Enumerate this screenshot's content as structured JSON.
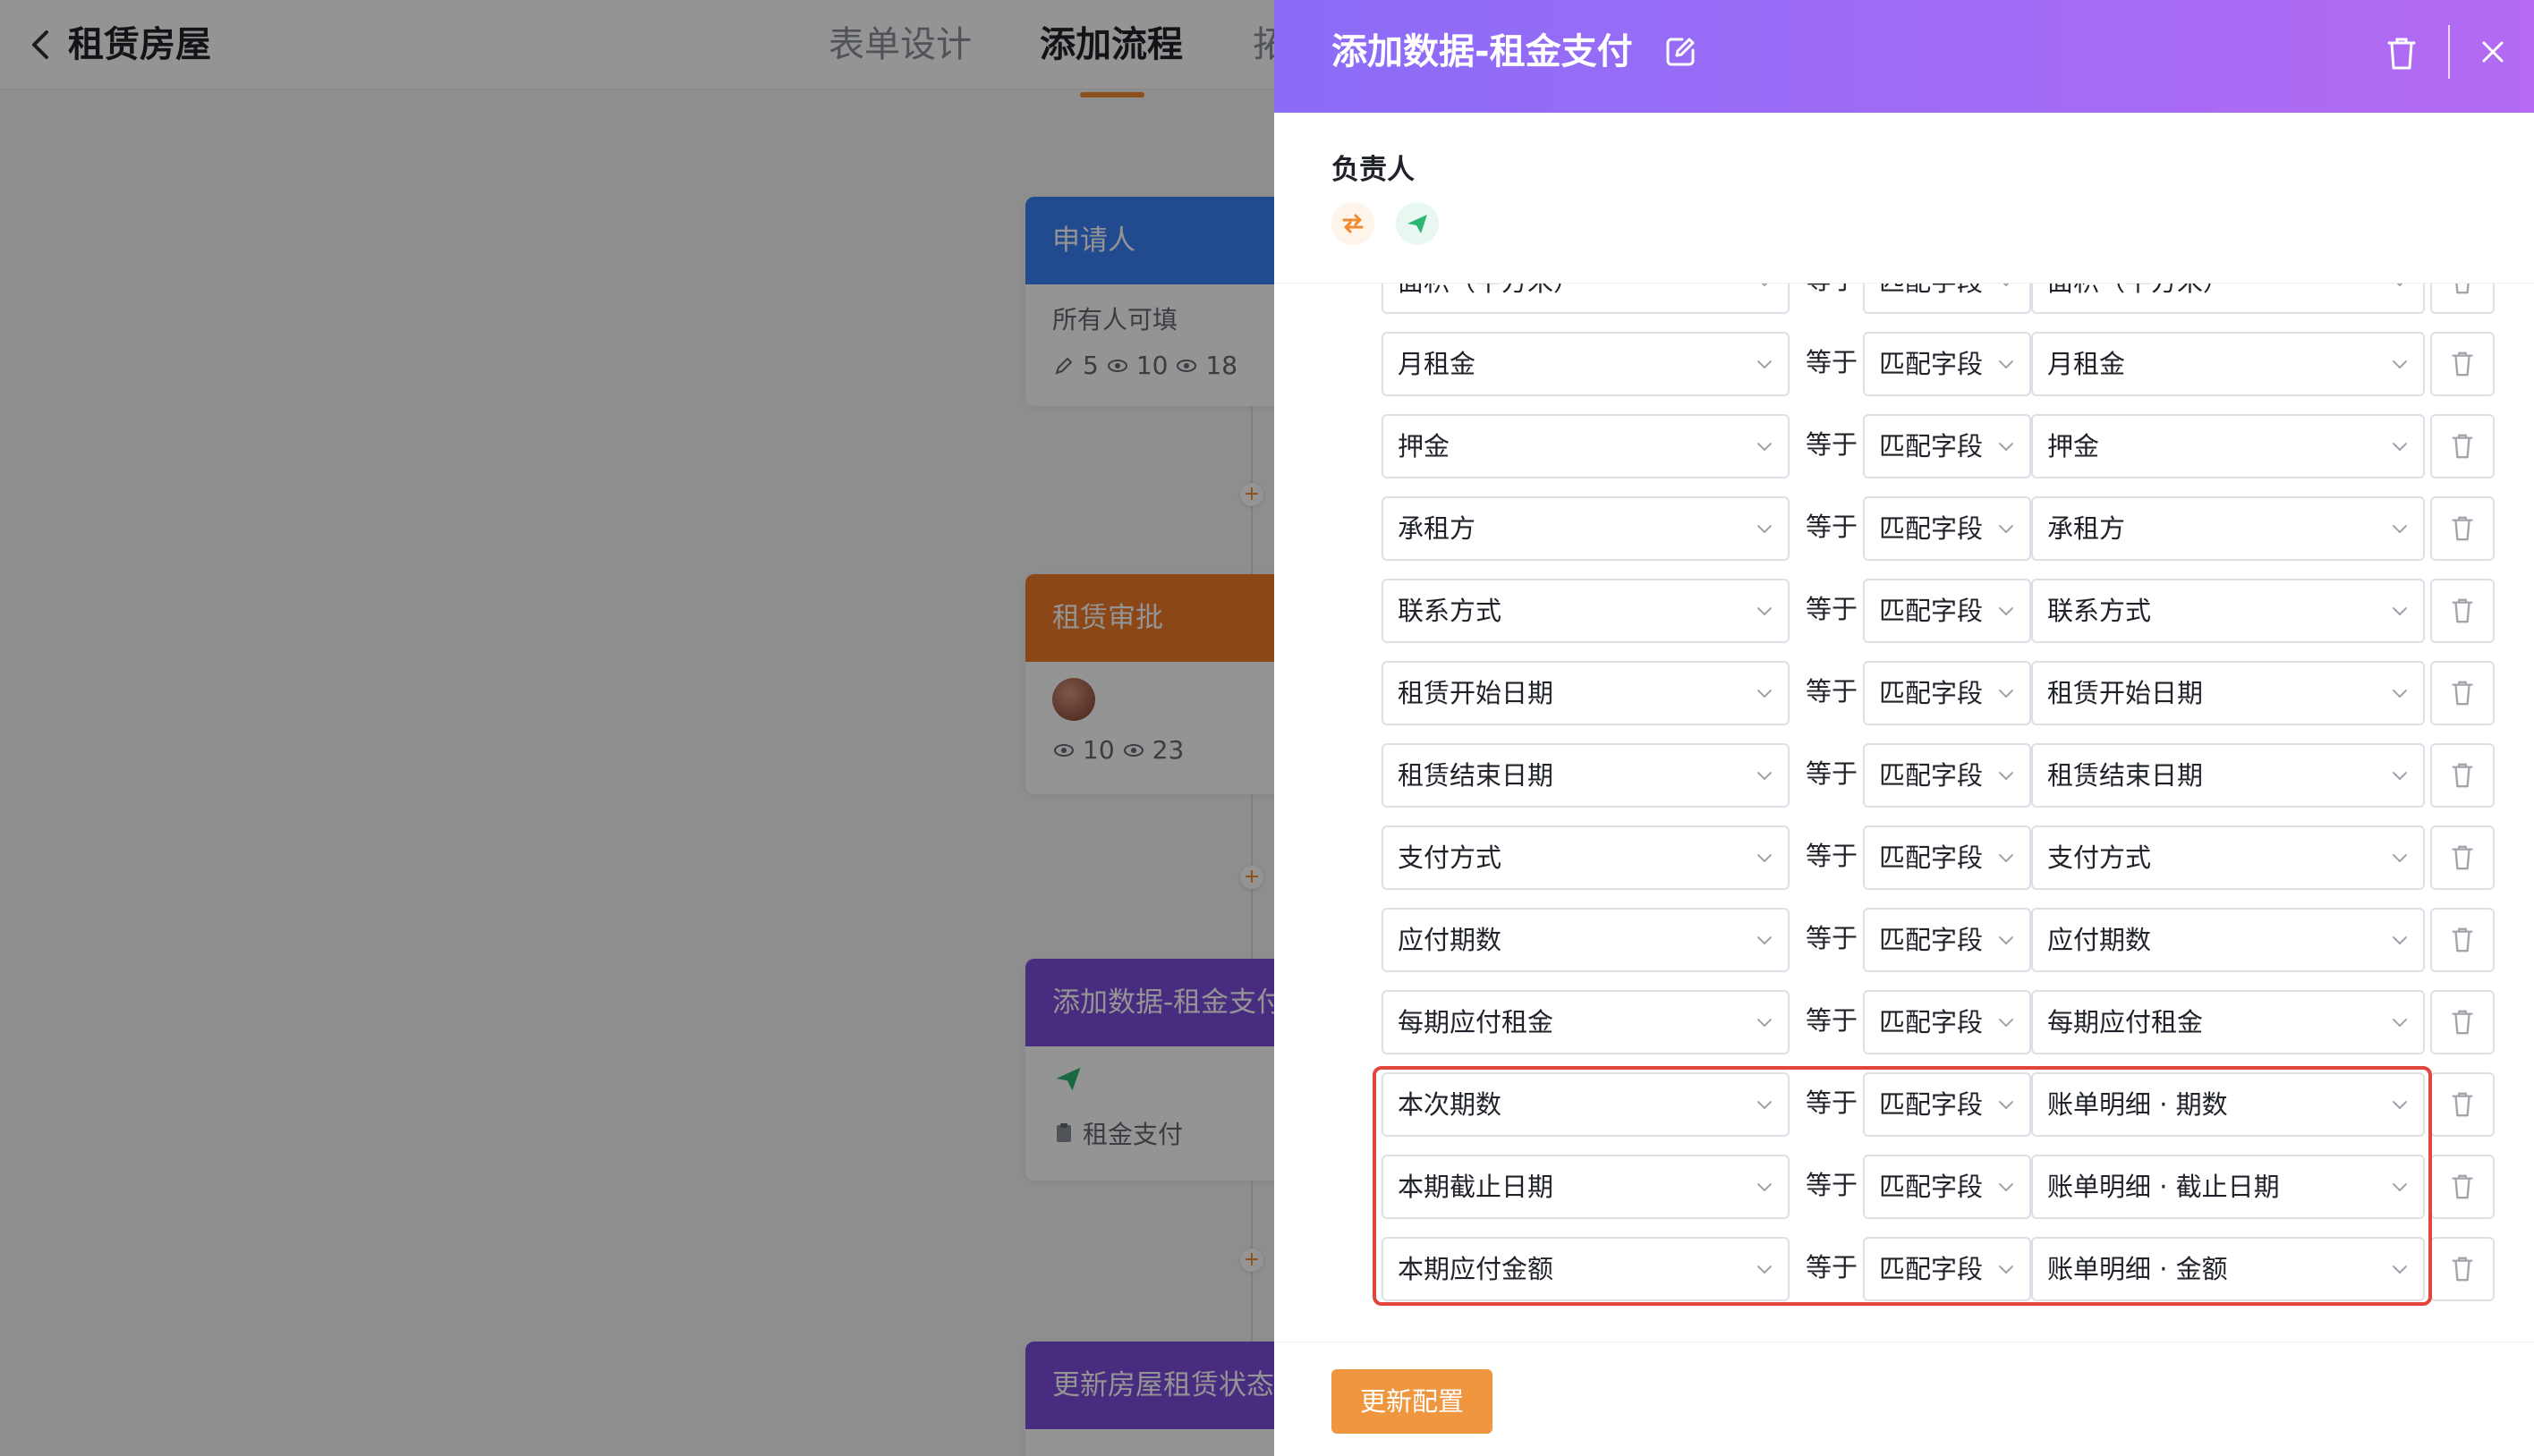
{
  "app": {
    "title": "租赁房屋",
    "tabs": [
      {
        "label": "表单设计"
      },
      {
        "label": "添加流程"
      },
      {
        "label": "拓"
      }
    ]
  },
  "flow": {
    "nodes": [
      {
        "title": "申请人",
        "subtitle": "所有人可填",
        "metrics": [
          "5",
          "10",
          "18"
        ],
        "color": "#3b82f6"
      },
      {
        "title": "租赁审批",
        "metrics": [
          "10",
          "23"
        ],
        "color": "#f07a2a"
      },
      {
        "title": "添加数据-租金支付",
        "detail": "租金支付",
        "color": "#7c4ddd"
      },
      {
        "title": "更新房屋租赁状态",
        "color": "#7c4ddd"
      }
    ],
    "plus": "+"
  },
  "drawer": {
    "title": "添加数据-租金支付",
    "owner_label": "负责人",
    "equals_text": "等于",
    "rows": [
      {
        "left": "面积（平方米）",
        "mode": "匹配字段",
        "right": "面积（平方米）"
      },
      {
        "left": "月租金",
        "mode": "匹配字段",
        "right": "月租金"
      },
      {
        "left": "押金",
        "mode": "匹配字段",
        "right": "押金"
      },
      {
        "left": "承租方",
        "mode": "匹配字段",
        "right": "承租方"
      },
      {
        "left": "联系方式",
        "mode": "匹配字段",
        "right": "联系方式"
      },
      {
        "left": "租赁开始日期",
        "mode": "匹配字段",
        "right": "租赁开始日期"
      },
      {
        "left": "租赁结束日期",
        "mode": "匹配字段",
        "right": "租赁结束日期"
      },
      {
        "left": "支付方式",
        "mode": "匹配字段",
        "right": "支付方式"
      },
      {
        "left": "应付期数",
        "mode": "匹配字段",
        "right": "应付期数"
      },
      {
        "left": "每期应付租金",
        "mode": "匹配字段",
        "right": "每期应付租金"
      },
      {
        "left": "本次期数",
        "mode": "匹配字段",
        "right": "账单明细 · 期数"
      },
      {
        "left": "本期截止日期",
        "mode": "匹配字段",
        "right": "账单明细 · 截止日期"
      },
      {
        "left": "本期应付金额",
        "mode": "匹配字段",
        "right": "账单明细 · 金额"
      }
    ],
    "update_button": "更新配置"
  },
  "colors": {
    "accent": "#f0963f",
    "header_gradient_start": "#8b6cf7",
    "header_gradient_end": "#b46af2",
    "highlight": "#e2453c"
  }
}
